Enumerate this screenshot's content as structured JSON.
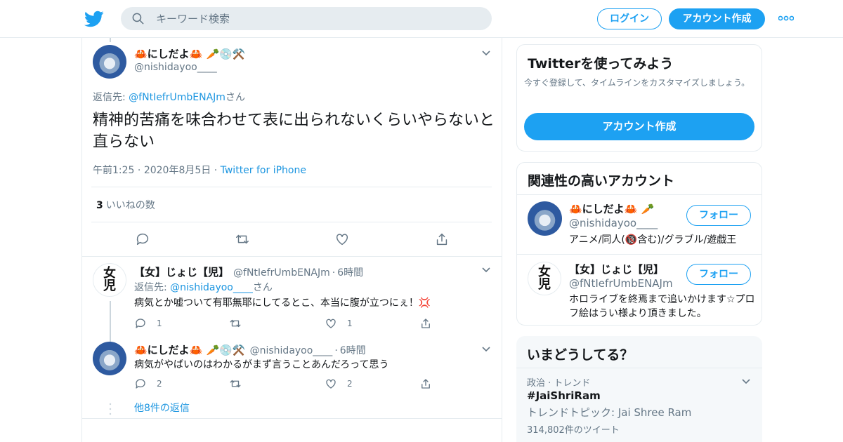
{
  "header": {
    "search_placeholder": "キーワード検索",
    "login_label": "ログイン",
    "signup_label": "アカウント作成"
  },
  "main_tweet": {
    "name": "🦀にしだよ🦀 🥕💿⚒️",
    "handle": "@nishidayoo____",
    "reply_to_prefix": "返信先: ",
    "reply_to_handle": "@fNtIefrUmbENAJm",
    "reply_to_suffix": "さん",
    "text": "精神的苦痛を味合わせて表に出られないくらいやらないと直らない",
    "time": "午前1:25",
    "date": "2020年8月5日",
    "via": "Twitter for iPhone",
    "like_count": "3",
    "like_label": "いいねの数"
  },
  "replies": [
    {
      "name": "【女】じょじ【児】",
      "handle": "@fNtIefrUmbENAJm",
      "time": "6時間",
      "reply_to_prefix": "返信先: ",
      "reply_to_handle": "@nishidayoo____",
      "reply_to_suffix": "さん",
      "text": "病気とか嘘ついて有耶無耶にしてるとこ、本当に腹が立つにぇ！💢",
      "reply_count": "1",
      "like_count": "1"
    },
    {
      "name": "🦀にしだよ🦀 🥕💿⚒️",
      "handle": "@nishidayoo____",
      "time": "6時間",
      "text": "病気がやばいのはわかるがまず言うことあんだろって思う",
      "reply_count": "2",
      "like_count": "2"
    }
  ],
  "more_replies": "他8件の返信",
  "sidebar": {
    "signup_card": {
      "title": "Twitterを使ってみよう",
      "body": "今すぐ登録して、タイムラインをカスタマイズしましょう。",
      "button": "アカウント作成"
    },
    "related": {
      "title": "関連性の高いアカウント",
      "follow_label": "フォロー",
      "accounts": [
        {
          "name": "🦀にしだよ🦀 🥕",
          "handle": "@nishidayoo____",
          "bio": "アニメ/同人(🔞含む)/グラブル/遊戯王"
        },
        {
          "name": "【女】じょじ【児】",
          "handle": "@fNtIefrUmbENAJm",
          "bio": "ホロライブを終焉まで追いかけます☆プロフ絵はうい様より頂きました。"
        }
      ]
    },
    "trends": {
      "title": "いまどうしてる？",
      "items": [
        {
          "context": "政治 · トレンド",
          "name": "#JaiShriRam",
          "topic": "トレンドトピック: Jai Shree Ram",
          "count": "314,802件のツイート"
        }
      ]
    }
  },
  "colors": {
    "accent": "#1da1f2",
    "link": "#1b95e0",
    "muted": "#657786",
    "border": "#e6ecf0"
  }
}
